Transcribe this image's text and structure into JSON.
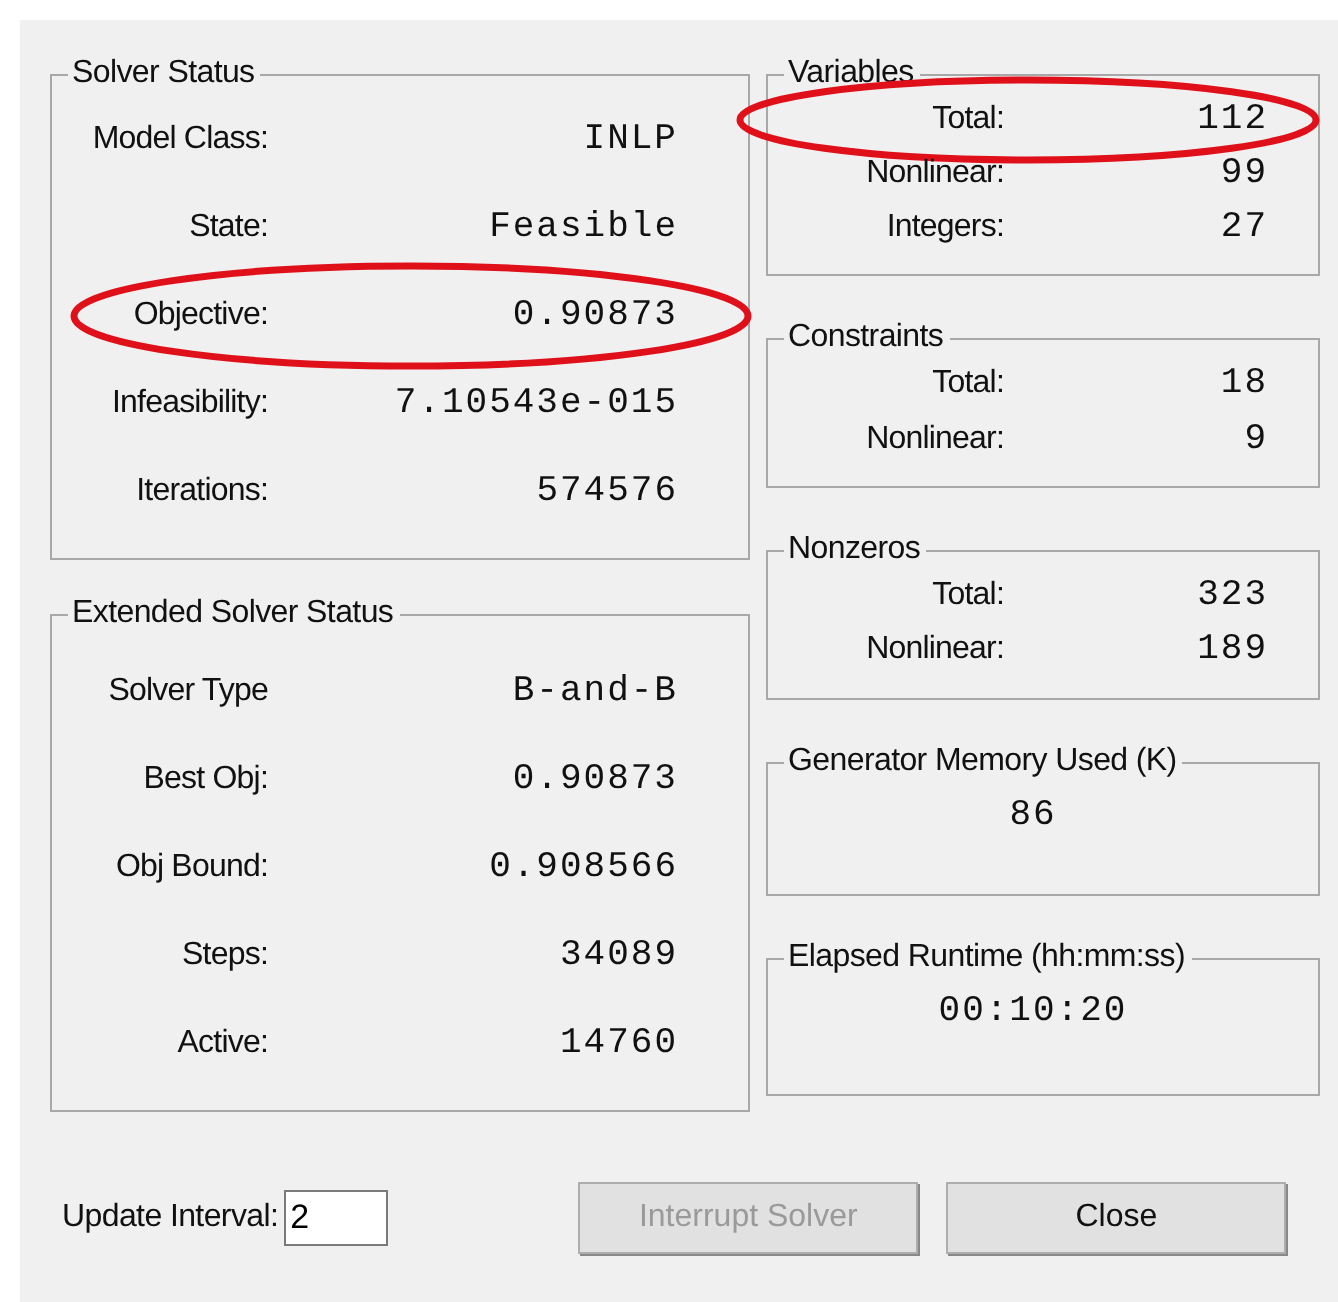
{
  "solver_status": {
    "title": "Solver Status",
    "rows": [
      {
        "label": "Model Class:",
        "value": "INLP",
        "circled": false
      },
      {
        "label": "State:",
        "value": "Feasible",
        "circled": false
      },
      {
        "label": "Objective:",
        "value": "0.90873",
        "circled": true
      },
      {
        "label": "Infeasibility:",
        "value": "7.10543e-015",
        "circled": false
      },
      {
        "label": "Iterations:",
        "value": "574576",
        "circled": false
      }
    ]
  },
  "extended_solver_status": {
    "title": "Extended Solver Status",
    "rows": [
      {
        "label": "Solver Type",
        "value": "B-and-B",
        "circled": false
      },
      {
        "label": "Best Obj:",
        "value": "0.90873",
        "circled": false
      },
      {
        "label": "Obj Bound:",
        "value": "0.908566",
        "circled": false
      },
      {
        "label": "Steps:",
        "value": "34089",
        "circled": false
      },
      {
        "label": "Active:",
        "value": "14760",
        "circled": false
      }
    ]
  },
  "variables": {
    "title": "Variables",
    "rows": [
      {
        "label": "Total:",
        "value": "112",
        "circled": true
      },
      {
        "label": "Nonlinear:",
        "value": "99",
        "circled": false
      },
      {
        "label": "Integers:",
        "value": "27",
        "circled": false
      }
    ]
  },
  "constraints": {
    "title": "Constraints",
    "rows": [
      {
        "label": "Total:",
        "value": "18",
        "circled": false
      },
      {
        "label": "Nonlinear:",
        "value": "9",
        "circled": false
      }
    ]
  },
  "nonzeros": {
    "title": "Nonzeros",
    "rows": [
      {
        "label": "Total:",
        "value": "323",
        "circled": false
      },
      {
        "label": "Nonlinear:",
        "value": "189",
        "circled": false
      }
    ]
  },
  "generator_memory": {
    "title": "Generator Memory Used (K)",
    "value": "86"
  },
  "elapsed_runtime": {
    "title": "Elapsed Runtime (hh:mm:ss)",
    "value": "00:10:20"
  },
  "update_interval": {
    "label": "Update Interval:",
    "value": "2"
  },
  "buttons": [
    {
      "label": "Interrupt Solver",
      "disabled": true
    },
    {
      "label": "Close",
      "disabled": false
    }
  ]
}
